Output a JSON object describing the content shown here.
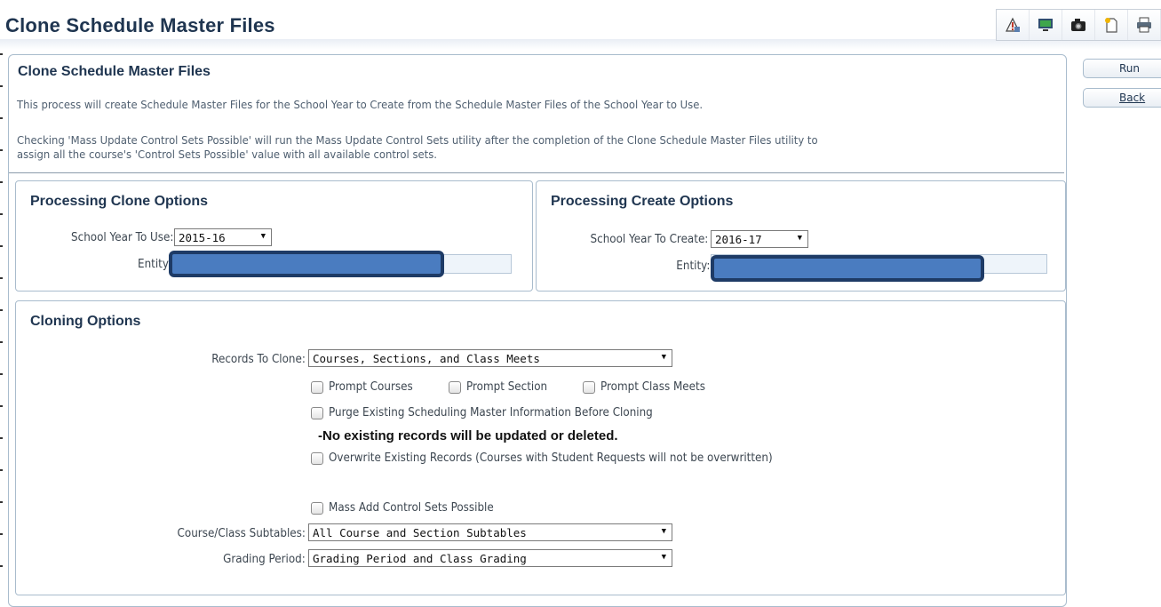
{
  "page": {
    "title": "Clone Schedule Master Files"
  },
  "toolbar": {
    "icons": [
      "report-icon",
      "monitor-icon",
      "camera-icon",
      "new-page-icon",
      "print-icon"
    ]
  },
  "actions": {
    "run_label": "Run",
    "back_label": "Back"
  },
  "main": {
    "heading": "Clone Schedule Master Files",
    "description_1": "This process will create Schedule Master Files for the School Year to Create from the Schedule Master Files of the School Year to Use.",
    "description_2a": "Checking 'Mass Update Control Sets Possible' will run the Mass Update Control Sets utility after the completion of the Clone Schedule Master Files utility to",
    "description_2b": "assign all the course's 'Control Sets Possible' value with all available control sets."
  },
  "clone_options": {
    "heading": "Processing Clone Options",
    "year_label": "School Year To Use:",
    "year_value": "2015-16",
    "entity_label": "Entity"
  },
  "create_options": {
    "heading": "Processing Create Options",
    "year_label": "School Year To Create:",
    "year_value": "2016-17",
    "entity_label": "Entity:"
  },
  "cloning": {
    "heading": "Cloning Options",
    "records_label": "Records To Clone:",
    "records_value": "Courses, Sections, and Class Meets",
    "prompt_courses": "Prompt Courses",
    "prompt_section": "Prompt Section",
    "prompt_class_meets": "Prompt Class Meets",
    "purge_label": "Purge Existing Scheduling Master Information Before Cloning",
    "warning": "-No existing records will be updated or deleted.",
    "overwrite_label": "Overwrite Existing Records (Courses with Student Requests will not be overwritten)",
    "mass_add_label": "Mass Add Control Sets Possible",
    "subtables_label": "Course/Class Subtables:",
    "subtables_value": "All Course and Section Subtables",
    "grading_label": "Grading Period:",
    "grading_value": "Grading Period and Class Grading"
  },
  "colors": {
    "heading": "#1f3550",
    "border": "#a9bccd",
    "redaction": "#4a7cc0"
  }
}
